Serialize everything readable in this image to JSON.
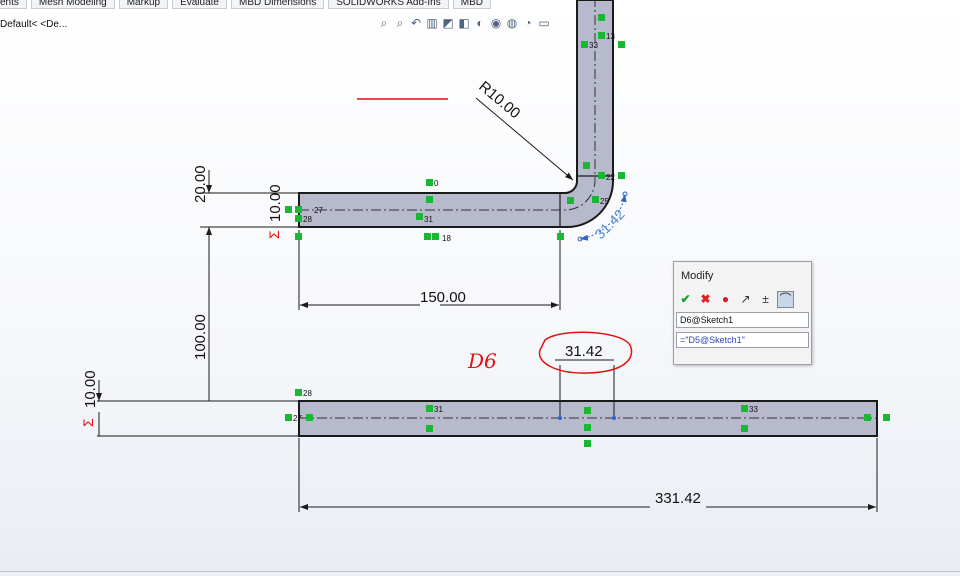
{
  "tabs": [
    "ents",
    "Mesh Modeling",
    "Markup",
    "Evaluate",
    "MBD Dimensions",
    "SOLIDWORKS Add-Ins",
    "MBD"
  ],
  "breadcrumb": "Default< <De...",
  "view_toolbar_icons": [
    "zoom-to-fit-icon",
    "zoom-area-icon",
    "previous-view-icon",
    "section-view-icon",
    "dynamic-annotation-icon",
    "view-orientation-icon",
    "display-style-icon",
    "hide-show-icon",
    "appearance-icon",
    "scene-icon",
    "view-settings-icon"
  ],
  "dimensions": {
    "radius": "R10.00",
    "angle_top": "20.00",
    "thick_top": "10.00",
    "length_top": "150.00",
    "arc": "31.42",
    "gap": "100.00",
    "thick_bottom": "10.00",
    "arc_bottom": "31.42",
    "total": "331.42"
  },
  "sketch_tags": {
    "t0": "0",
    "t31a": "31",
    "t18": "18",
    "t27a": "27",
    "t28a": "28",
    "t33a": "33",
    "t13": "13",
    "t22": "22",
    "t25": "25",
    "t28b": "28",
    "t27b": "27",
    "t31b": "31",
    "t33b": "33"
  },
  "sigma_glyph": "Σ",
  "handwritten_note": "D6",
  "modify_dialog": {
    "title": "Modify",
    "dimension_name": "D6@Sketch1",
    "equation_value": "=\"D5@Sketch1\"",
    "tools": [
      "ok-icon",
      "cancel-icon",
      "rebuild-icon",
      "reverse-icon",
      "spin-increment-icon",
      "mark-for-drawing-icon"
    ]
  },
  "colors": {
    "part_fill": "#b7b9cd",
    "relation_green": "#18b832",
    "sketch_blue": "#2f62c8",
    "annotation_red": "#e01212",
    "dimension_dark": "#1a1a1a"
  }
}
